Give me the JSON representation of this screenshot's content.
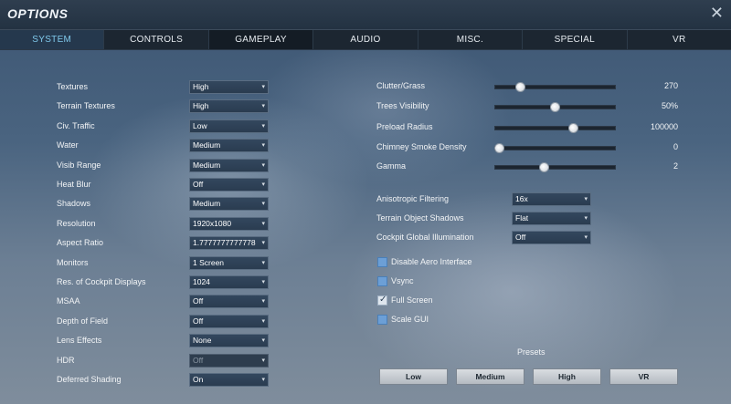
{
  "window": {
    "title": "OPTIONS",
    "close_label": "✕"
  },
  "tabs": [
    {
      "label": "SYSTEM"
    },
    {
      "label": "CONTROLS"
    },
    {
      "label": "GAMEPLAY"
    },
    {
      "label": "AUDIO"
    },
    {
      "label": "MISC."
    },
    {
      "label": "SPECIAL"
    },
    {
      "label": "VR"
    }
  ],
  "left_settings": [
    {
      "label": "Textures",
      "value": "High"
    },
    {
      "label": "Terrain Textures",
      "value": "High"
    },
    {
      "label": "Civ. Traffic",
      "value": "Low"
    },
    {
      "label": "Water",
      "value": "Medium"
    },
    {
      "label": "Visib Range",
      "value": "Medium"
    },
    {
      "label": "Heat Blur",
      "value": "Off"
    },
    {
      "label": "Shadows",
      "value": "Medium"
    },
    {
      "label": "Resolution",
      "value": "1920x1080"
    },
    {
      "label": "Aspect Ratio",
      "value": "1.7777777777778"
    },
    {
      "label": "Monitors",
      "value": "1 Screen"
    },
    {
      "label": "Res. of Cockpit Displays",
      "value": "1024"
    },
    {
      "label": "MSAA",
      "value": "Off"
    },
    {
      "label": "Depth of Field",
      "value": "Off"
    },
    {
      "label": "Lens Effects",
      "value": "None"
    },
    {
      "label": "HDR",
      "value": "Off"
    },
    {
      "label": "Deferred Shading",
      "value": "On"
    }
  ],
  "sliders": [
    {
      "label": "Clutter/Grass",
      "value": "270",
      "fraction": 0.19
    },
    {
      "label": "Trees Visibility",
      "value": "50%",
      "fraction": 0.5
    },
    {
      "label": "Preload Radius",
      "value": "100000",
      "fraction": 0.66
    },
    {
      "label": "Chimney Smoke Density",
      "value": "0",
      "fraction": 0.0
    },
    {
      "label": "Gamma",
      "value": "2",
      "fraction": 0.4
    }
  ],
  "right_dropdowns": [
    {
      "label": "Anisotropic Filtering",
      "value": "16x"
    },
    {
      "label": "Terrain Object Shadows",
      "value": "Flat"
    },
    {
      "label": "Cockpit Global Illumination",
      "value": "Off"
    }
  ],
  "checkboxes": [
    {
      "label": "Disable Aero Interface",
      "checked": false
    },
    {
      "label": "Vsync",
      "checked": false
    },
    {
      "label": "Full Screen",
      "checked": true
    },
    {
      "label": "Scale GUI",
      "checked": false
    }
  ],
  "presets": {
    "label": "Presets",
    "buttons": [
      "Low",
      "Medium",
      "High",
      "VR"
    ]
  },
  "colors": {
    "active_tab_text": "#7fc8ea",
    "checkbox_unchecked": "#6c9fd6",
    "checkbox_checked": "#dfe6ee"
  }
}
